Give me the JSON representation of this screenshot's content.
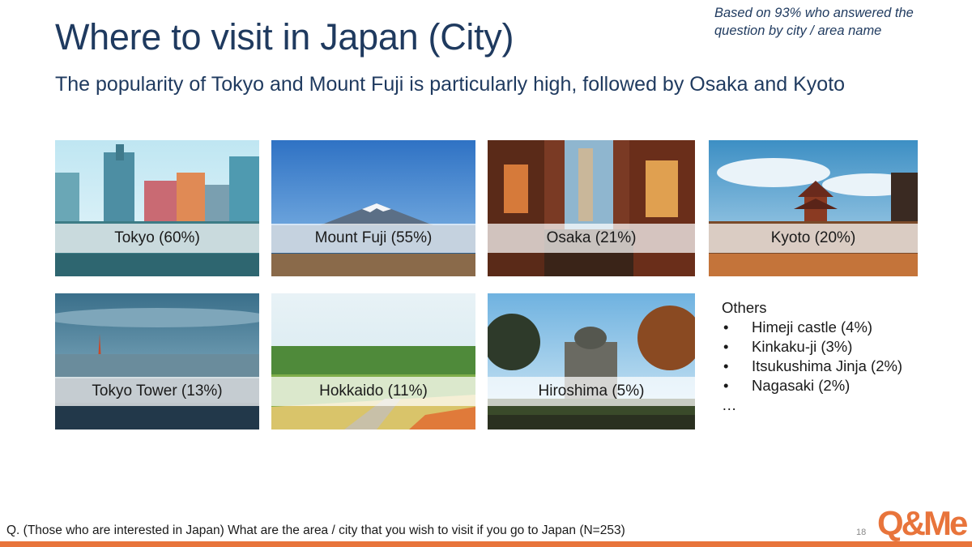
{
  "title": "Where to visit in Japan (City)",
  "note": "Based on 93% who answered the question by city / area name",
  "subtitle": "The popularity of Tokyo and Mount Fuji is particularly high, followed by Osaka and Kyoto",
  "destinations": [
    {
      "label": "Tokyo (60%)",
      "share_pct": 60
    },
    {
      "label": "Mount Fuji (55%)",
      "share_pct": 55
    },
    {
      "label": "Osaka (21%)",
      "share_pct": 21
    },
    {
      "label": "Kyoto (20%)",
      "share_pct": 20
    },
    {
      "label": "Tokyo Tower (13%)",
      "share_pct": 13
    },
    {
      "label": "Hokkaido (11%)",
      "share_pct": 11
    },
    {
      "label": "Hiroshima (5%)",
      "share_pct": 5
    }
  ],
  "others": {
    "heading": "Others",
    "items": [
      "Himeji castle (4%)",
      "Kinkaku-ji (3%)",
      "Itsukushima Jinja (2%)",
      "Nagasaki (2%)"
    ],
    "bullet": "•",
    "more": "…"
  },
  "question": "Q. (Those who are interested in Japan) What are the area / city that you wish to visit if you go to Japan (N=253)",
  "page_number": "18",
  "logo": {
    "text": "Q&Me",
    "color": "#e8743b",
    "accent": "#2a6fb5"
  },
  "colors": {
    "title": "#1f3a5f",
    "footer_bar": "#e8743b"
  }
}
